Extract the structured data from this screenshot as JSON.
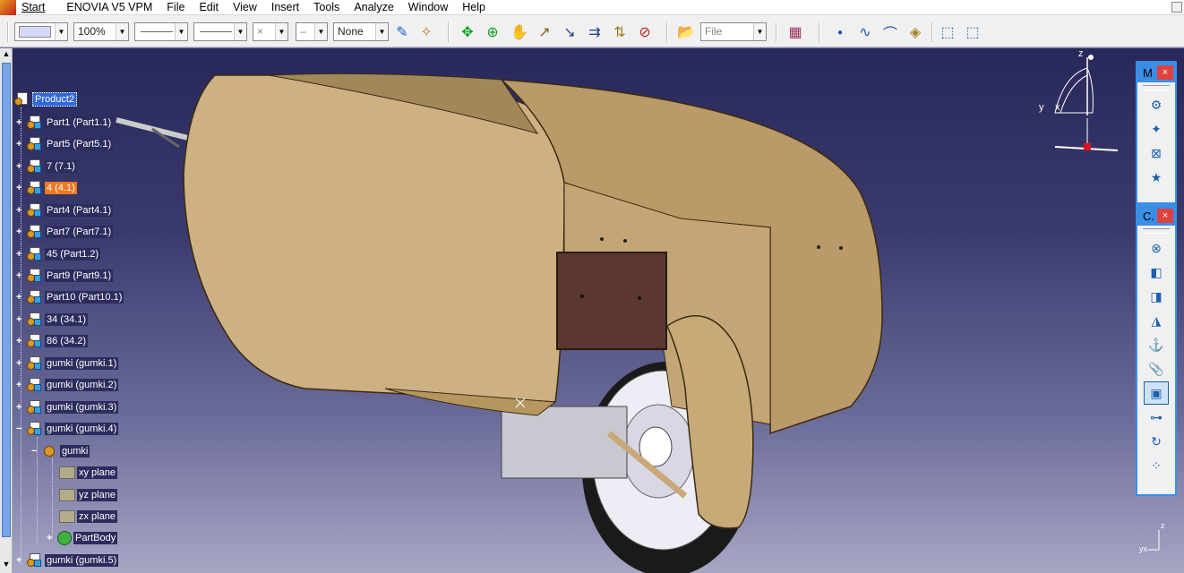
{
  "menubar": {
    "items": [
      "Start",
      "ENOVIA V5 VPM",
      "File",
      "Edit",
      "View",
      "Insert",
      "Tools",
      "Analyze",
      "Window",
      "Help"
    ]
  },
  "toolbar": {
    "color_combo": "",
    "zoom_combo": "100%",
    "line_type_combo": "",
    "line_weight_combo": "",
    "point_combo": "×",
    "layer_combo": "–",
    "layer_name_combo": "None",
    "file_combo": "File"
  },
  "tree": {
    "root": "Product2",
    "items": [
      "Part1 (Part1.1)",
      "Part5 (Part5.1)",
      "7 (7.1)",
      "4 (4.1)",
      "Part4 (Part4.1)",
      "Part7 (Part7.1)",
      "45 (Part1.2)",
      "Part9 (Part9.1)",
      "Part10 (Part10.1)",
      "34 (34.1)",
      "86 (34.2)",
      "gumki (gumki.1)",
      "gumki (gumki.2)",
      "gumki (gumki.3)",
      "gumki (gumki.4)"
    ],
    "sub_part": "gumki",
    "sub_items": [
      "xy plane",
      "yz plane",
      "zx plane",
      "PartBody"
    ],
    "last_item": "gumki (gumki.5)"
  },
  "compass": {
    "z": "z",
    "y": "y",
    "x": "x"
  },
  "float_toolbar_1": {
    "title": "M",
    "close": "×"
  },
  "float_toolbar_2": {
    "title": "C.",
    "close": "×"
  },
  "mini_axes": {
    "z": "z",
    "yx": "yx"
  },
  "colors": {
    "background_top": "#28285a",
    "background_bottom": "#a6a6c4",
    "body": "#cbaf80",
    "panel": "#5a3a30",
    "selected": "#3368d8",
    "highlight": "#f07820",
    "float_border": "#3a8ee6"
  }
}
